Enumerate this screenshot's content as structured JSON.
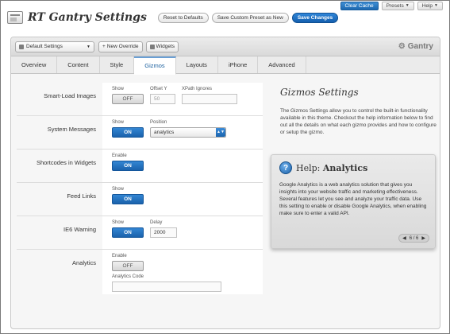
{
  "admin_bar": {
    "clear_cache": "Clear Cache",
    "presets": "Presets",
    "help": "Help"
  },
  "header": {
    "title": "RT Gantry Settings",
    "reset_label": "Reset to Defaults",
    "save_preset_label": "Save Custom Preset as New",
    "save_label": "Save Changes"
  },
  "toolbar": {
    "preset_select": "Default Settings",
    "new_override": "New Override",
    "widgets": "Widgets",
    "brand": "Gantry"
  },
  "tabs": [
    "Overview",
    "Content",
    "Style",
    "Gizmos",
    "Layouts",
    "iPhone",
    "Advanced"
  ],
  "active_tab": "Gizmos",
  "settings": {
    "smartload": {
      "label": "Smart-Load Images",
      "show_label": "Show",
      "show_value": "OFF",
      "offset_label": "Offset Y",
      "offset_value": "50",
      "xpath_label": "XPath Ignores",
      "xpath_value": ""
    },
    "messages": {
      "label": "System Messages",
      "show_label": "Show",
      "show_value": "ON",
      "position_label": "Position",
      "position_value": "analytics"
    },
    "shortcodes": {
      "label": "Shortcodes in Widgets",
      "enable_label": "Enable",
      "enable_value": "ON"
    },
    "feed": {
      "label": "Feed Links",
      "show_label": "Show",
      "show_value": "ON"
    },
    "ie6": {
      "label": "IE6 Warning",
      "show_label": "Show",
      "show_value": "ON",
      "delay_label": "Delay",
      "delay_value": "2000"
    },
    "analytics": {
      "label": "Analytics",
      "enable_label": "Enable",
      "enable_value": "OFF",
      "code_label": "Analytics Code",
      "code_value": ""
    }
  },
  "sidebar": {
    "title": "Gizmos Settings",
    "description": "The Gizmos Settings allow you to control the built-in functionality available in this theme. Checkout the help information below to find out all the details on what each gizmo provides and how to configure or setup the gizmo."
  },
  "help": {
    "prefix": "Help:",
    "topic": "Analytics",
    "text": "Google Analytics is a web analytics solution that gives you insights into your website traffic and marketing effectiveness. Several features let you see and analyze your traffic data. Use this setting to enable or disable Google Analytics, when enabling make sure to enter a valid API.",
    "pager": "6 / 6"
  },
  "colors": {
    "accent": "#1c68b0",
    "active_tab_text": "#1a5f9e"
  }
}
